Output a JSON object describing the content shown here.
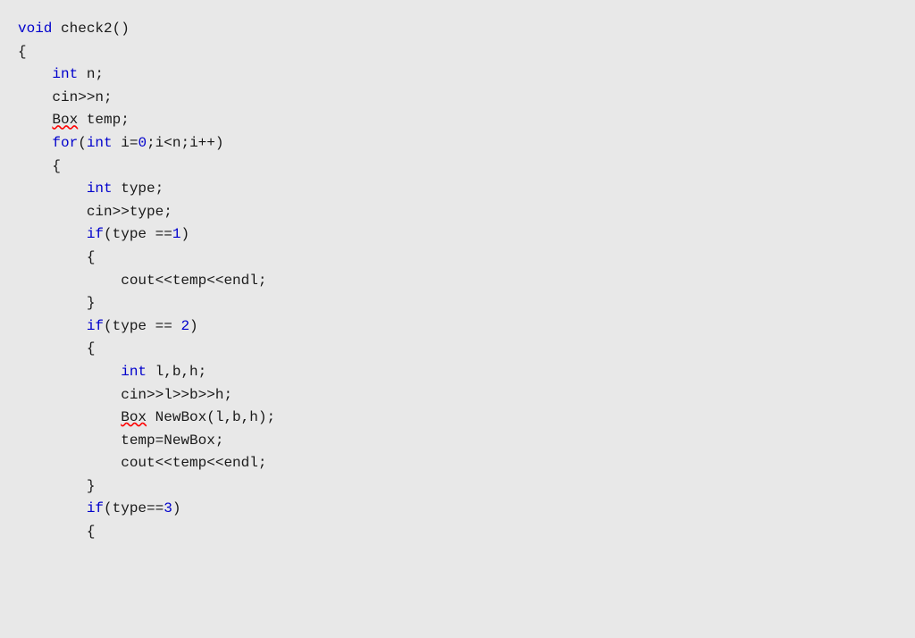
{
  "code": {
    "lines": [
      {
        "id": "l1",
        "indent": 0,
        "tokens": [
          {
            "text": "void",
            "class": "kw-void"
          },
          {
            "text": " check2()",
            "class": ""
          }
        ]
      },
      {
        "id": "l2",
        "indent": 0,
        "tokens": [
          {
            "text": "{",
            "class": ""
          }
        ]
      },
      {
        "id": "l3",
        "indent": 1,
        "tokens": [
          {
            "text": "int",
            "class": "kw-blue"
          },
          {
            "text": " n;",
            "class": ""
          }
        ]
      },
      {
        "id": "l4",
        "indent": 1,
        "tokens": [
          {
            "text": "cin>>n;",
            "class": ""
          }
        ]
      },
      {
        "id": "l5",
        "indent": 1,
        "tokens": [
          {
            "text": "Box",
            "class": "squiggly"
          },
          {
            "text": " temp;",
            "class": ""
          }
        ]
      },
      {
        "id": "l6",
        "indent": 1,
        "tokens": [
          {
            "text": "for",
            "class": "kw-blue"
          },
          {
            "text": "(",
            "class": ""
          },
          {
            "text": "int",
            "class": "kw-blue"
          },
          {
            "text": " i=",
            "class": ""
          },
          {
            "text": "0",
            "class": "num"
          },
          {
            "text": ";i<n;i++)",
            "class": ""
          }
        ]
      },
      {
        "id": "l7",
        "indent": 1,
        "tokens": [
          {
            "text": "{",
            "class": ""
          }
        ]
      },
      {
        "id": "l8",
        "indent": 2,
        "tokens": [
          {
            "text": "int",
            "class": "kw-blue"
          },
          {
            "text": " type;",
            "class": ""
          }
        ]
      },
      {
        "id": "l9",
        "indent": 2,
        "tokens": [
          {
            "text": "cin>>type;",
            "class": ""
          }
        ]
      },
      {
        "id": "l10",
        "indent": 2,
        "tokens": [
          {
            "text": "if",
            "class": "kw-blue"
          },
          {
            "text": "(type ==",
            "class": ""
          },
          {
            "text": "1",
            "class": "num"
          },
          {
            "text": ")",
            "class": ""
          }
        ]
      },
      {
        "id": "l11",
        "indent": 2,
        "tokens": [
          {
            "text": "{",
            "class": ""
          }
        ]
      },
      {
        "id": "l12",
        "indent": 3,
        "tokens": [
          {
            "text": "cout<<temp<<endl;",
            "class": ""
          }
        ]
      },
      {
        "id": "l13",
        "indent": 2,
        "tokens": [
          {
            "text": "}",
            "class": ""
          }
        ]
      },
      {
        "id": "l14",
        "indent": 2,
        "tokens": [
          {
            "text": "if",
            "class": "kw-blue"
          },
          {
            "text": "(type == ",
            "class": ""
          },
          {
            "text": "2",
            "class": "num"
          },
          {
            "text": ")",
            "class": ""
          }
        ]
      },
      {
        "id": "l15",
        "indent": 2,
        "tokens": [
          {
            "text": "{",
            "class": ""
          }
        ]
      },
      {
        "id": "l16",
        "indent": 3,
        "tokens": [
          {
            "text": "int",
            "class": "kw-blue"
          },
          {
            "text": " l,b,h;",
            "class": ""
          }
        ]
      },
      {
        "id": "l17",
        "indent": 3,
        "tokens": [
          {
            "text": "cin>>l>>b>>h;",
            "class": ""
          }
        ]
      },
      {
        "id": "l18",
        "indent": 3,
        "tokens": [
          {
            "text": "Box",
            "class": "squiggly"
          },
          {
            "text": " NewBox(l,b,h);",
            "class": ""
          }
        ]
      },
      {
        "id": "l19",
        "indent": 3,
        "tokens": [
          {
            "text": "temp=NewBox;",
            "class": ""
          }
        ]
      },
      {
        "id": "l20",
        "indent": 3,
        "tokens": [
          {
            "text": "cout<<temp<<endl;",
            "class": ""
          }
        ]
      },
      {
        "id": "l21",
        "indent": 2,
        "tokens": [
          {
            "text": "}",
            "class": ""
          }
        ]
      },
      {
        "id": "l22",
        "indent": 2,
        "tokens": [
          {
            "text": "if",
            "class": "kw-blue"
          },
          {
            "text": "(type==",
            "class": ""
          },
          {
            "text": "3",
            "class": "num"
          },
          {
            "text": ")",
            "class": ""
          }
        ]
      },
      {
        "id": "l23",
        "indent": 2,
        "tokens": [
          {
            "text": "{",
            "class": ""
          }
        ]
      }
    ],
    "indent_size": 4
  }
}
